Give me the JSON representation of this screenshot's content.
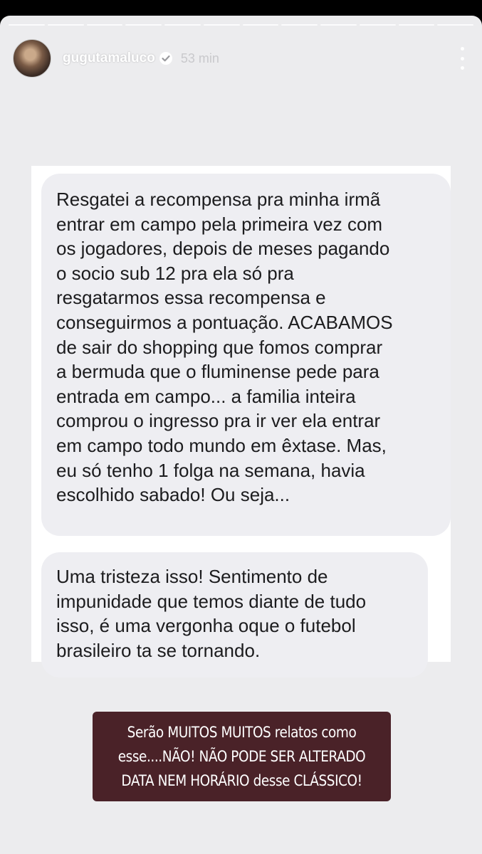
{
  "story": {
    "progress_segments": 12,
    "header": {
      "username": "gugutamaluco",
      "verified_icon": "verified-badge-icon",
      "time": "53 min",
      "more_icon": "more-options-icon"
    },
    "message_1": {
      "lines": [
        "Resgatei a recompensa pra minha irmã",
        "entrar em campo pela primeira vez com",
        "os jogadores, depois de meses pagando",
        "o socio sub 12 pra ela só pra",
        "resgatarmos essa recompensa e",
        "conseguirmos a pontuação. ACABAMOS",
        "de sair do shopping que fomos comprar",
        "a bermuda que o fluminense pede para",
        "entrada em campo... a familia inteira",
        "comprou o ingresso pra ir ver ela entrar",
        "em campo todo mundo em êxtase. Mas,",
        "eu só tenho 1 folga na semana, havia",
        "escolhido sabado! Ou seja..."
      ]
    },
    "message_2": {
      "lines": [
        "Uma tristeza isso! Sentimento de",
        "impunidade que temos diante de tudo",
        "isso, é uma vergonha oque o futebol",
        "brasileiro ta se tornando."
      ]
    },
    "caption": {
      "lines": [
        "Serão MUITOS MUITOS relatos como",
        "esse....NÃO! NÃO PODE SER ALTERADO",
        "DATA NEM HORÁRIO desse CLÁSSICO!"
      ],
      "background": "#4a2228"
    }
  }
}
